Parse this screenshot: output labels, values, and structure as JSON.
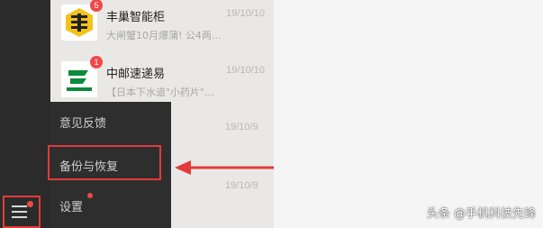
{
  "chats": [
    {
      "name": "丰巢智能柜",
      "preview": "大闸蟹10月爆蒲! 公4两...",
      "time": "19/10/10",
      "badge": "5",
      "avatar_icon": "hive-box-logo"
    },
    {
      "name": "中邮速递易",
      "preview": "【日本下水道\"小药片\"...",
      "time": "19/10/10",
      "badge": "1",
      "avatar_icon": "china-post-logo"
    }
  ],
  "hidden_times": [
    "19/10/9",
    "19/10/9"
  ],
  "menu": {
    "items": [
      "意见反馈",
      "备份与恢复",
      "设置"
    ]
  },
  "watermark": "头条 @手机科技先锋",
  "colors": {
    "accent_red": "#e23a3a",
    "badge_red": "#f04747",
    "sidebar": "#2b2b2b",
    "menu": "#2e2e2e"
  }
}
